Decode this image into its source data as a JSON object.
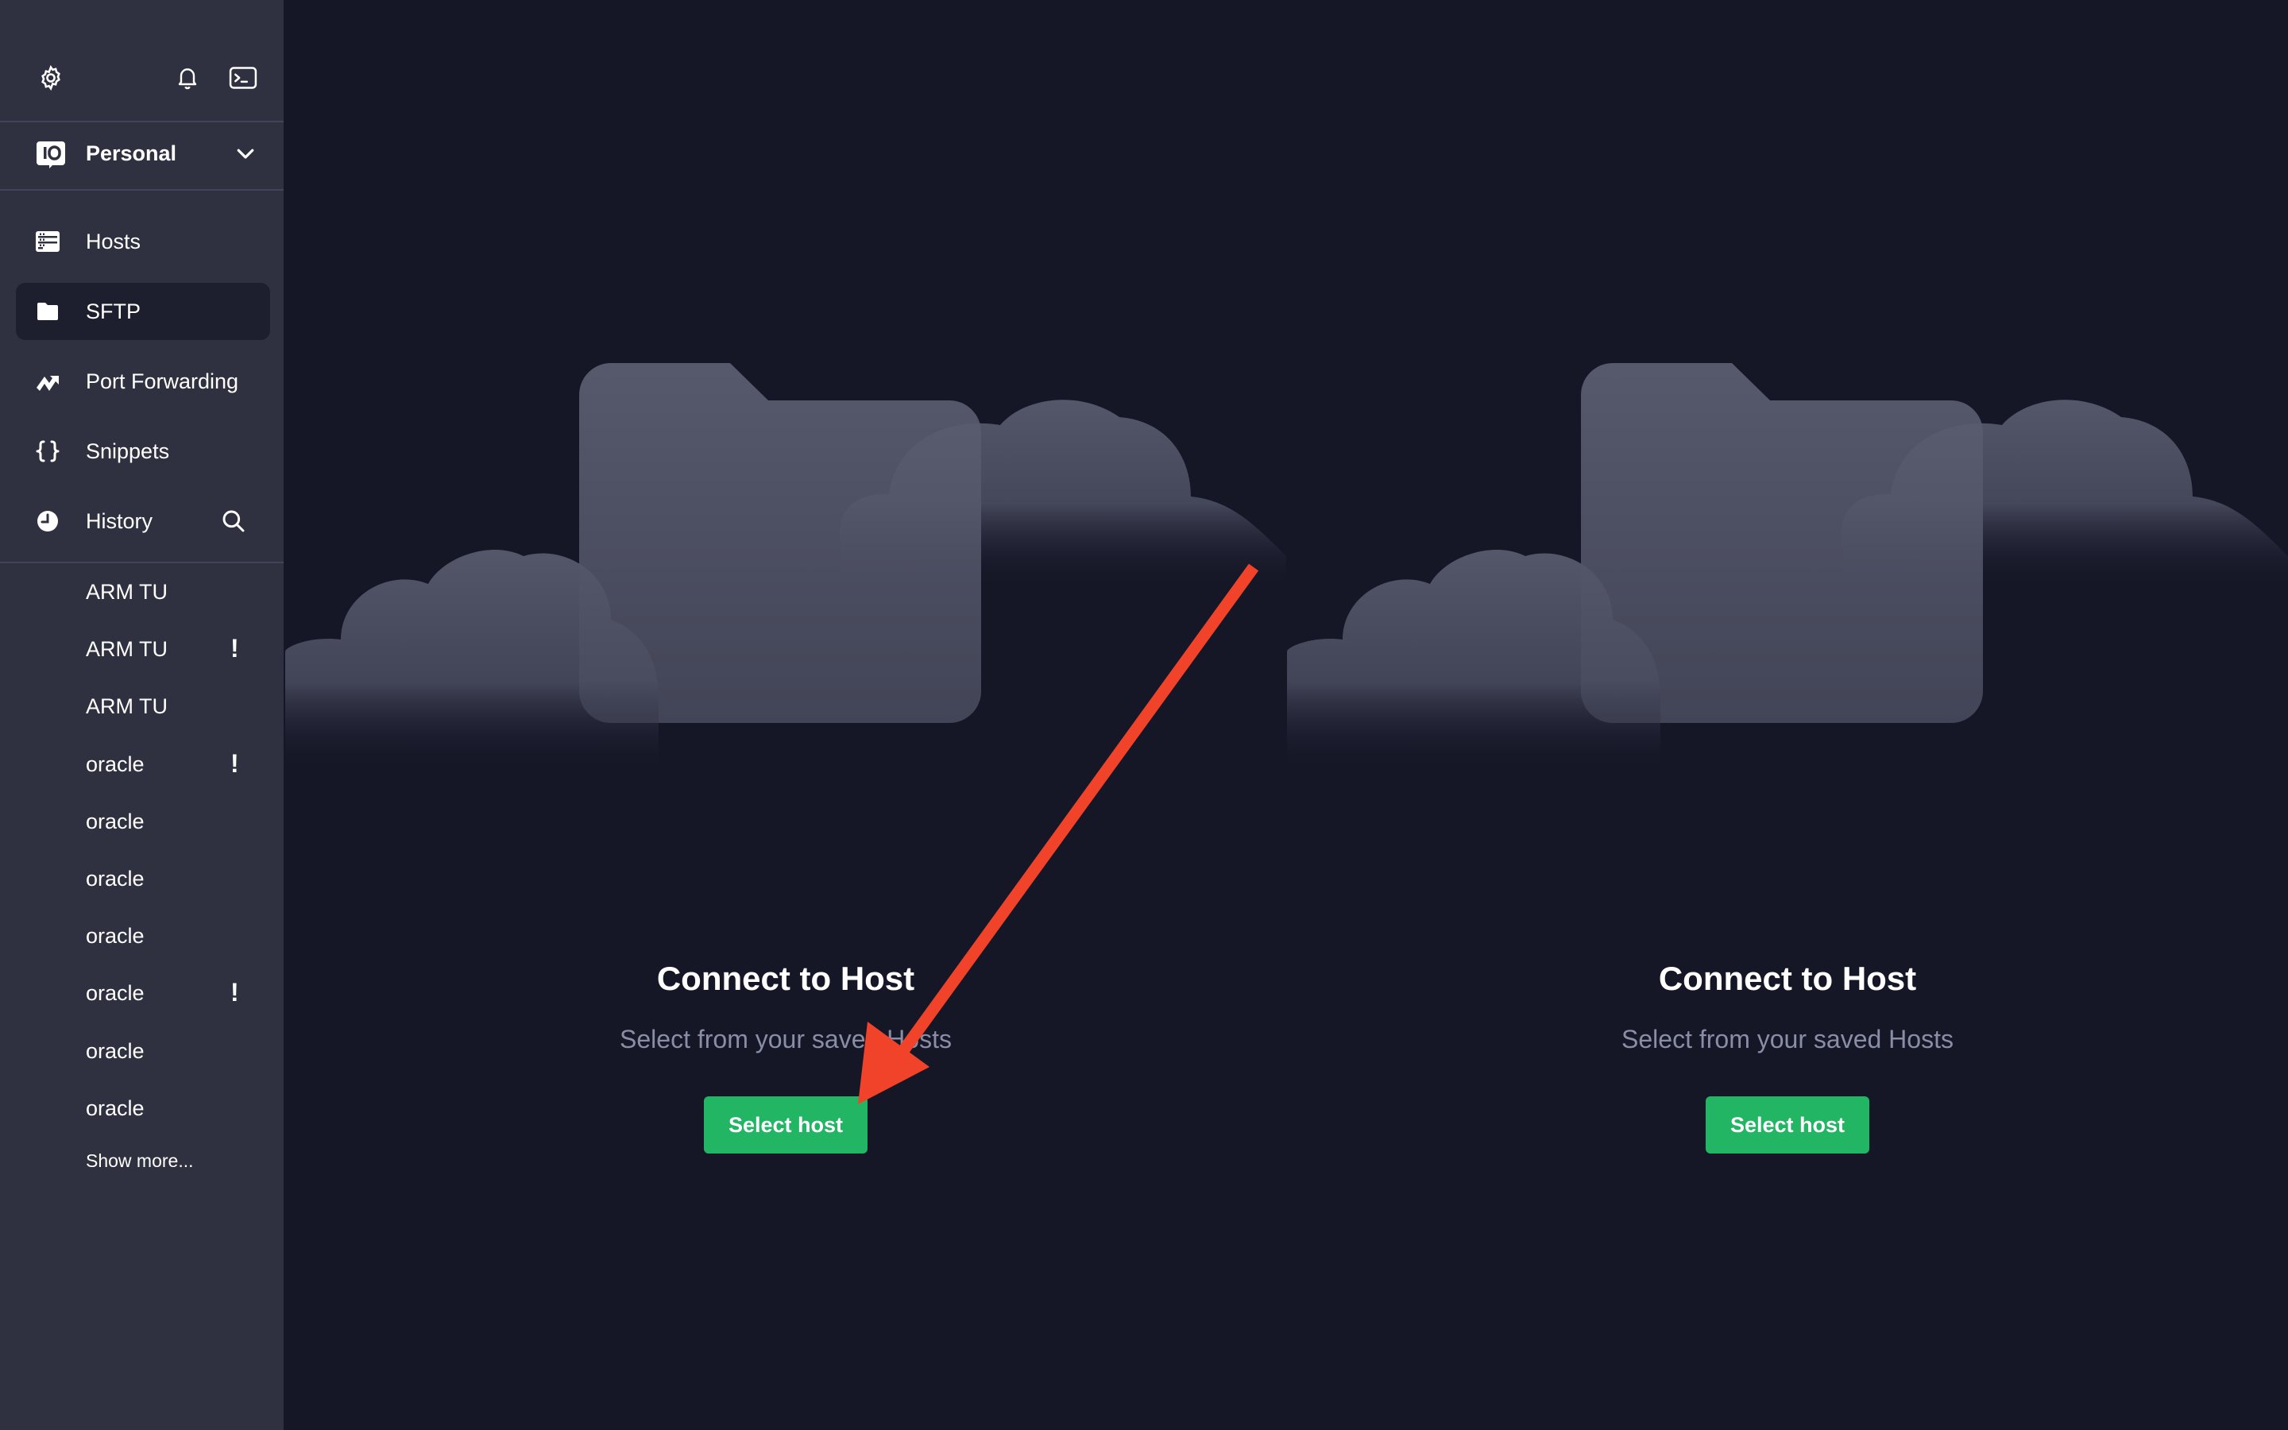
{
  "sidebar": {
    "top_icons": [
      "gear-icon",
      "bell-icon",
      "terminal-icon"
    ],
    "workspace": {
      "name": "Personal",
      "icon": "workspace-icon"
    },
    "nav": [
      {
        "label": "Hosts",
        "icon": "hosts-icon",
        "active": false
      },
      {
        "label": "SFTP",
        "icon": "folder-icon",
        "active": true
      },
      {
        "label": "Port Forwarding",
        "icon": "port-forwarding-icon",
        "active": false
      },
      {
        "label": "Snippets",
        "icon": "braces-icon",
        "active": false
      },
      {
        "label": "History",
        "icon": "clock-icon",
        "active": false
      }
    ],
    "history": [
      {
        "label": "ARM TU",
        "warning": ""
      },
      {
        "label": "ARM TU",
        "warning": "!"
      },
      {
        "label": "ARM TU",
        "warning": ""
      },
      {
        "label": "oracle",
        "warning": "!"
      },
      {
        "label": "oracle",
        "warning": ""
      },
      {
        "label": "oracle",
        "warning": ""
      },
      {
        "label": "oracle",
        "warning": ""
      },
      {
        "label": "oracle",
        "warning": "!"
      },
      {
        "label": "oracle",
        "warning": ""
      },
      {
        "label": "oracle",
        "warning": ""
      }
    ],
    "show_more": "Show more..."
  },
  "panes": [
    {
      "title": "Connect to Host",
      "subtitle": "Select from your saved Hosts",
      "button": "Select host"
    },
    {
      "title": "Connect to Host",
      "subtitle": "Select from your saved Hosts",
      "button": "Select host"
    }
  ],
  "colors": {
    "background": "#151727",
    "sidebar": "#2f3140",
    "accent_green": "#22b664",
    "annotation_arrow": "#f0432a"
  }
}
